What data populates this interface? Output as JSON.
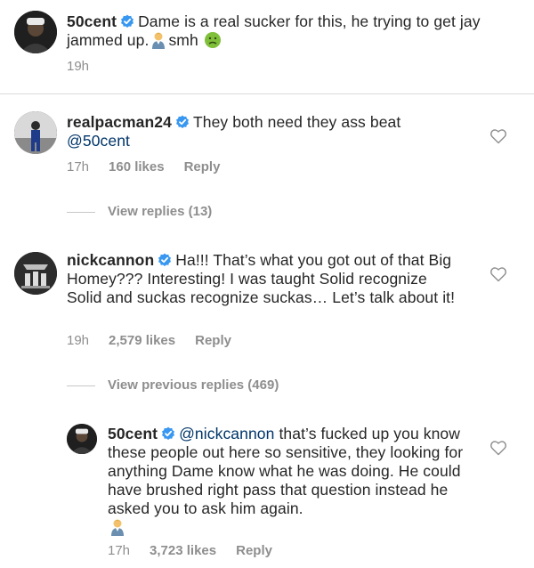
{
  "comments": [
    {
      "username": "50cent",
      "body": "Dame is a real sucker for this, he trying to get jay jammed up.",
      "trail": "smh",
      "time": "19h"
    },
    {
      "username": "realpacman24",
      "body": "They both need they ass beat",
      "mention": "@50cent",
      "time": "17h",
      "likes": "160 likes",
      "reply": "Reply",
      "view_replies": "View replies (13)"
    },
    {
      "username": "nickcannon",
      "body": "Ha!!! That’s what you got out of that Big Homey??? Interesting! I was taught Solid recognize Solid and suckas recognize suckas… Let’s talk about it!",
      "time": "19h",
      "likes": "2,579 likes",
      "reply": "Reply",
      "view_replies": "View previous replies (469)"
    },
    {
      "username": "50cent",
      "mention": "@nickcannon",
      "body": "that’s fucked up you know these people out here so sensitive, they looking for anything Dame know what he was doing. He could have brushed right pass that question instead he asked you to ask him again.",
      "time": "17h",
      "likes": "3,723 likes",
      "reply": "Reply"
    }
  ],
  "icons": {
    "verified": "verified-badge-icon",
    "like": "heart-outline-icon",
    "emoji_1": "man-in-tuxedo-emoji",
    "emoji_2": "nauseated-face-emoji"
  },
  "colors": {
    "verified": "#3897f0",
    "mention": "#003569",
    "meta": "#8e8e8e"
  }
}
